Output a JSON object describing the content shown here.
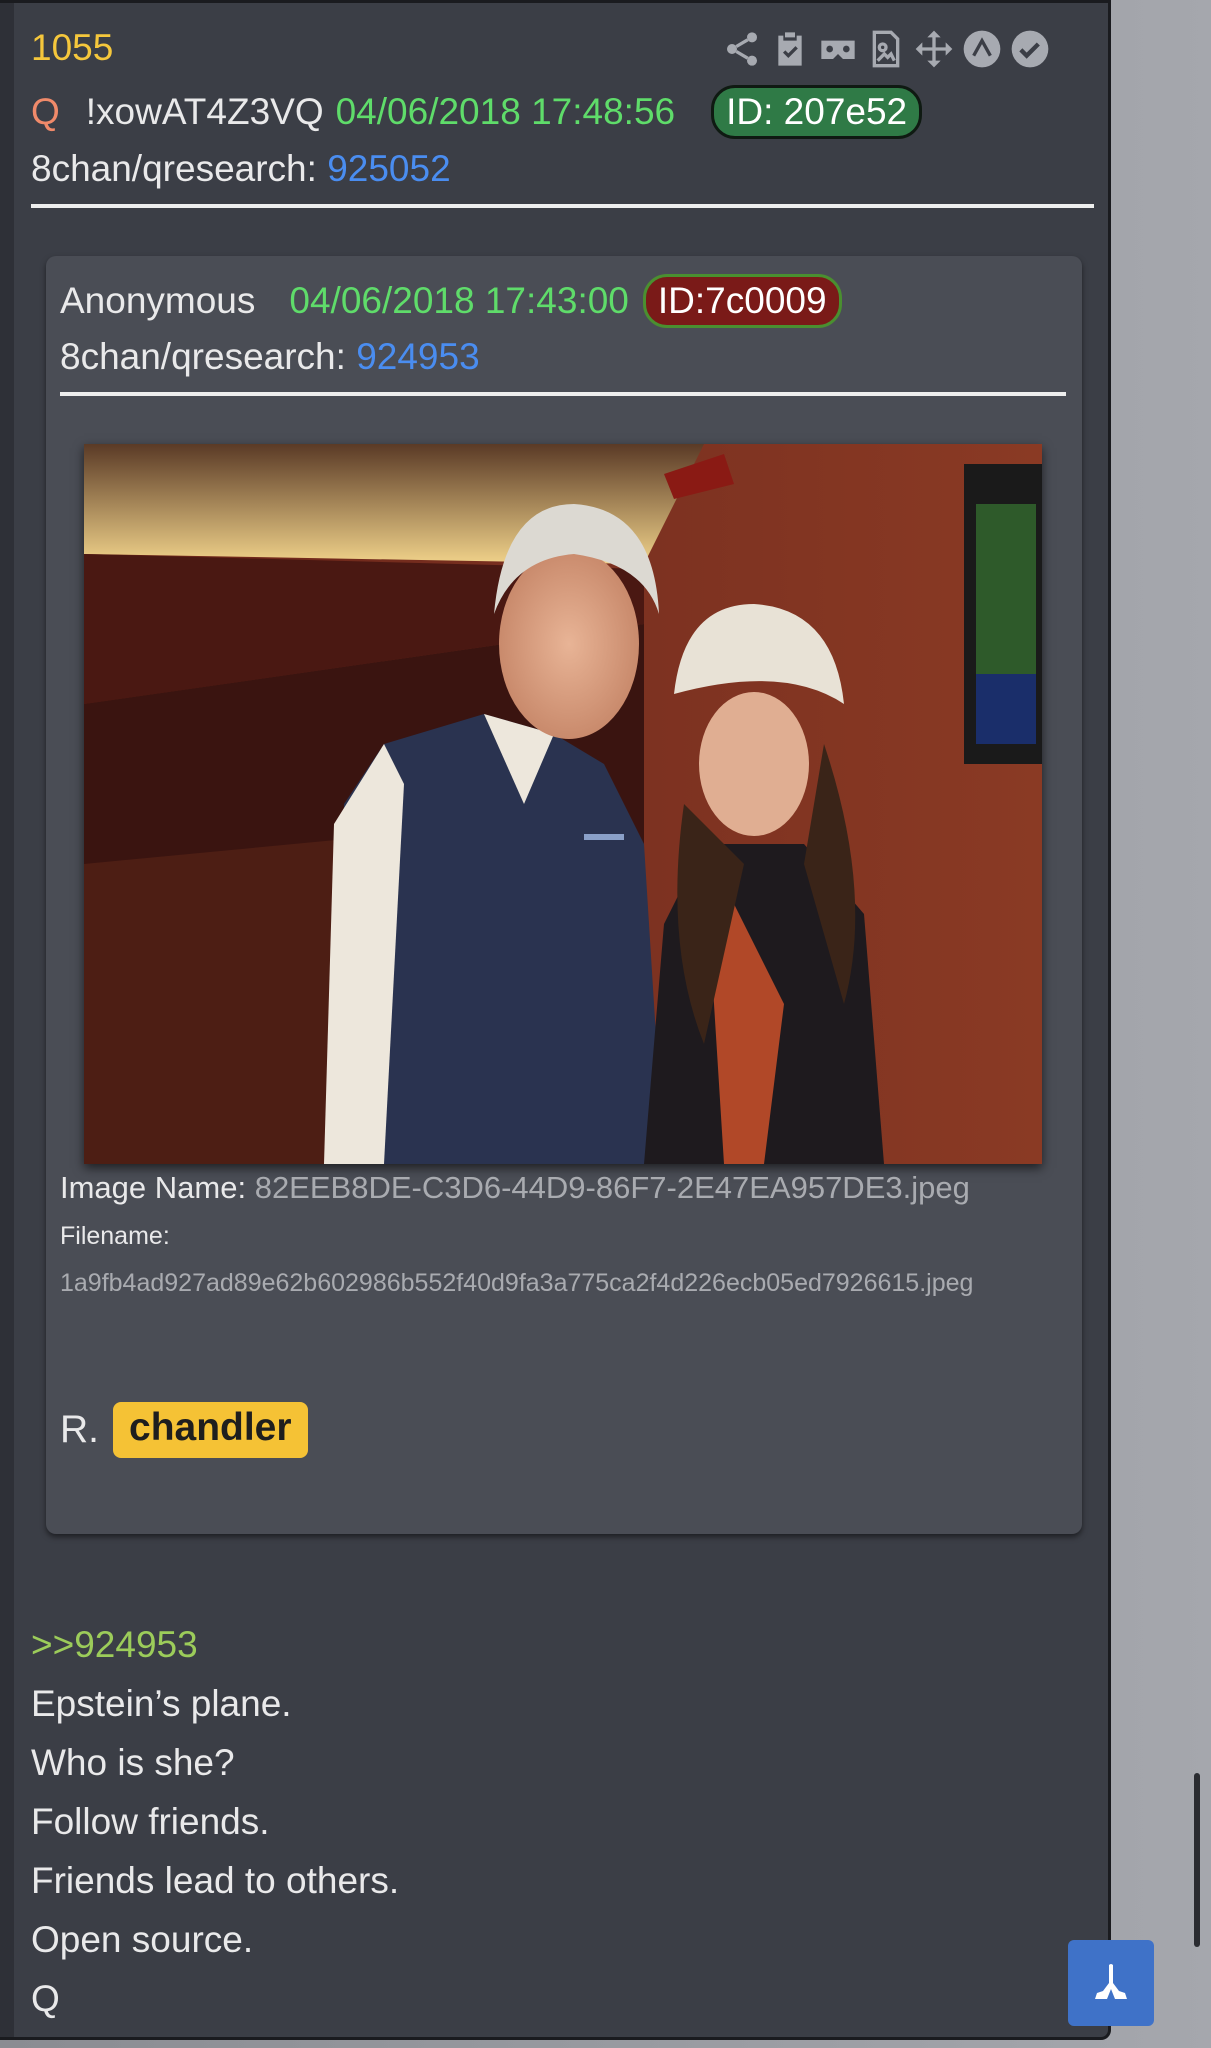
{
  "post": {
    "number": "1055",
    "author_symbol": "Q",
    "tripcode": "!xowAT4Z3VQ",
    "datetime": "04/06/2018 17:48:56",
    "id_label": "ID: 207e52",
    "board": "8chan/qresearch:",
    "post_ref": "925052"
  },
  "toolbar": {
    "icons": [
      "share-icon",
      "clipboard-check-icon",
      "vr-goggles-icon",
      "document-image-icon",
      "move-arrows-icon",
      "up-arrow-circle-icon",
      "checkmark-circle-icon"
    ]
  },
  "quoted": {
    "author": "Anonymous",
    "datetime": "04/06/2018 17:43:00",
    "id_label": "ID:7c0009",
    "board": "8chan/qresearch:",
    "post_ref": "924953",
    "image_name_label": "Image Name:",
    "image_name": "82EEB8DE-C3D6-44D9-86F7-2E47EA957DE3.jpeg",
    "filename_label": "Filename:",
    "filename": "1a9fb4ad927ad89e62b602986b552f40d9fa3a775ca2f4d226ecb05ed7926615.jpeg",
    "text_prefix": "R.",
    "tag": "chandler"
  },
  "message": {
    "reply_link": ">>924953",
    "lines": [
      "Epstein’s plane.",
      "Who is she?",
      "Follow friends.",
      "Friends lead to others.",
      "Open source.",
      "Q"
    ]
  },
  "colors": {
    "background": "#3b3e46",
    "post_number": "#f5c73c",
    "timestamp_green": "#5fdc6a",
    "link_blue": "#4a8df0",
    "tag_yellow": "#f5c235"
  }
}
